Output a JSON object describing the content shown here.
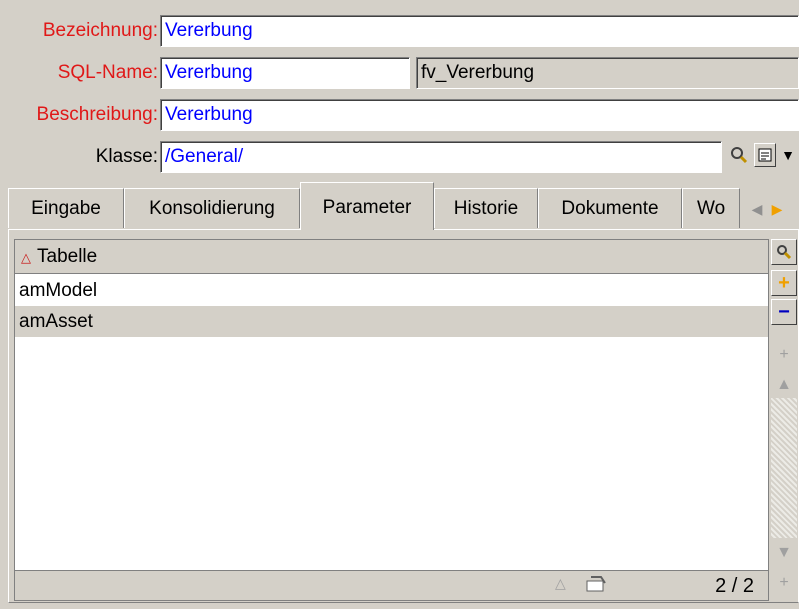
{
  "form": {
    "bezeichnung_label": "Bezeichnung:",
    "bezeichnung_value": "Vererbung",
    "sqlname_label": "SQL-Name:",
    "sqlname_value": "Vererbung",
    "sqlname_extra": "fv_Vererbung",
    "beschreibung_label": "Beschreibung:",
    "beschreibung_value": "Vererbung",
    "klasse_label": "Klasse:",
    "klasse_value": "/General/"
  },
  "tabs": [
    {
      "label": "Eingabe"
    },
    {
      "label": "Konsolidierung"
    },
    {
      "label": "Parameter"
    },
    {
      "label": "Historie"
    },
    {
      "label": "Dokumente"
    },
    {
      "label": "Wo"
    }
  ],
  "list": {
    "column_header": "Tabelle",
    "rows": [
      {
        "value": "amModel"
      },
      {
        "value": "amAsset"
      }
    ],
    "count": "2 / 2"
  },
  "icons": {
    "search": "magnifier-icon",
    "form_view": "form-view-icon",
    "add": "plus-icon",
    "remove": "minus-icon"
  },
  "colors": {
    "required_label": "#e01818",
    "link_text": "#0000ff",
    "add_icon": "#f0a000",
    "remove_icon": "#0000c0"
  }
}
